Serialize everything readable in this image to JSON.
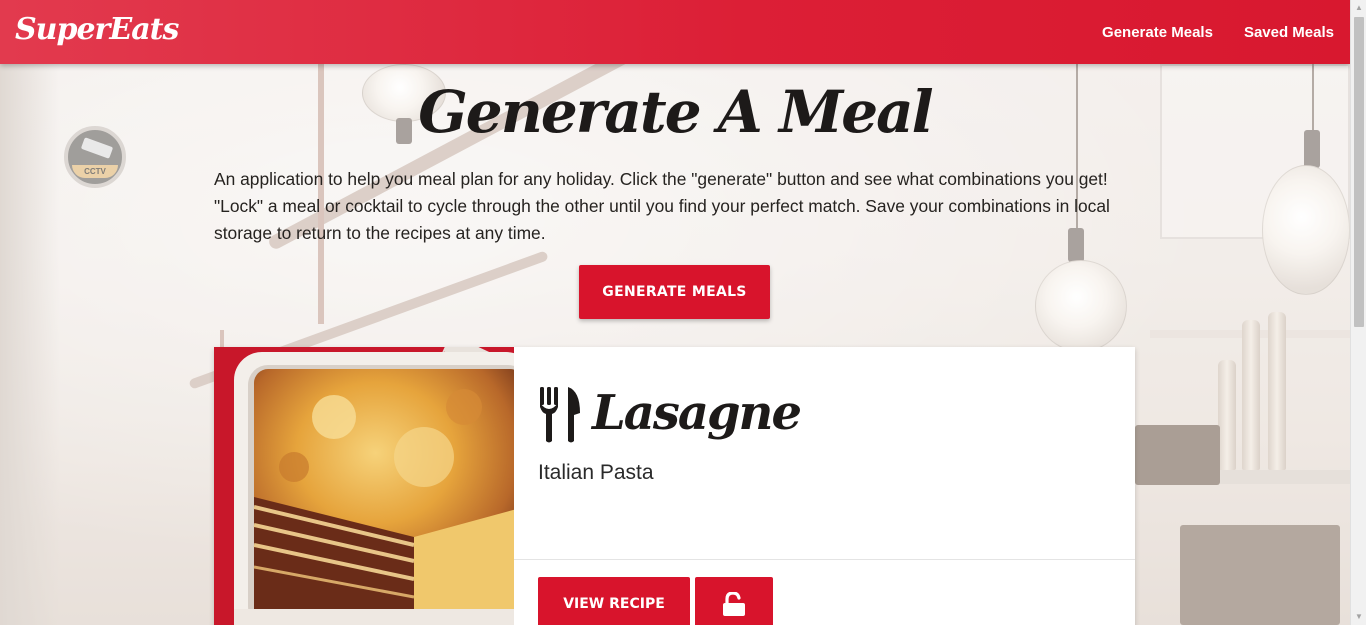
{
  "navbar": {
    "brand": "SuperEats",
    "links": [
      {
        "label": "Generate Meals"
      },
      {
        "label": "Saved Meals"
      }
    ]
  },
  "header": {
    "title": "Generate A Meal",
    "intro": "An application to help you meal plan for any holiday. Click the \"generate\" button and see what combinations you get! \"Lock\" a meal or cocktail to cycle through the other until you find your perfect match. Save your combinations in local storage to return to the recipes at any time.",
    "generate_button": "GENERATE MEALS"
  },
  "background": {
    "cctv_label": "CCTV"
  },
  "meal_card": {
    "icon": "utensils-icon",
    "name": "Lasagne",
    "category": "Italian Pasta",
    "view_button": "VIEW RECIPE",
    "lock_icon": "unlock-icon",
    "lock_locked": false
  },
  "colors": {
    "accent": "#d8142c",
    "navbar_start": "#e23a4e",
    "navbar_end": "#d8182f"
  }
}
